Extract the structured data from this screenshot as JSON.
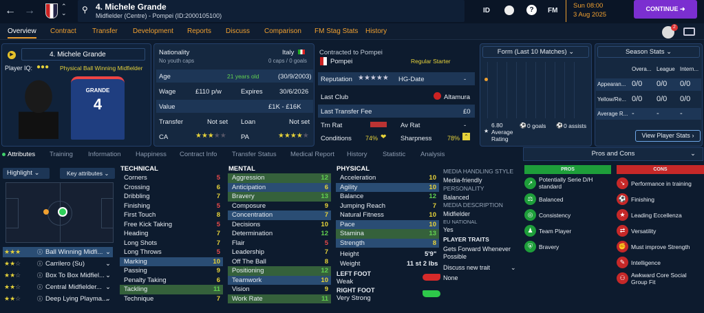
{
  "header": {
    "player_title": "4. Michele Grande",
    "subtitle": "Midfielder (Centre) - Pompei (ID:2000105100)",
    "id_label": "ID",
    "fm_label": "FM",
    "day_time": "Sun 08:00",
    "date": "3 Aug 2025",
    "continue_label": "CONTINUE",
    "notif_count": "2"
  },
  "nav": [
    "Overview",
    "Contract",
    "Transfer",
    "Development",
    "Reports",
    "Discuss",
    "Comparison",
    "FM Stag Stats",
    "History"
  ],
  "profile": {
    "name": "4. Michele Grande",
    "player_iq_label": "Player IQ:",
    "role": "Physical Ball Winning Midfielder",
    "shirt_name": "GRANDE",
    "shirt_number": "4"
  },
  "info": {
    "nationality_label": "Nationality",
    "nationality": "Italy",
    "youth_caps": "No youth caps",
    "caps": "0 caps / 0 goals",
    "age_label": "Age",
    "age": "21 years old",
    "dob": "(30/9/2003)",
    "wage_label": "Wage",
    "wage": "£110 p/w",
    "expires_label": "Expires",
    "expires": "30/6/2026",
    "value_label": "Value",
    "value": "£1K - £16K",
    "transfer_label": "Transfer",
    "transfer": "Not set",
    "loan_label": "Loan",
    "loan": "Not set",
    "ca_label": "CA",
    "pa_label": "PA"
  },
  "club": {
    "contracted_label": "Contracted to Pompei",
    "club": "Pompei",
    "status": "Regular Starter",
    "reputation_label": "Reputation",
    "hg_label": "HG-Date",
    "hg_value": "-",
    "last_club_label": "Last Club",
    "last_club": "Altamura",
    "last_fee_label": "Last Transfer Fee",
    "last_fee": "£0",
    "trn_label": "Trn Rat",
    "av_label": "Av Rat",
    "av_value": "-",
    "conditions_label": "Conditions",
    "conditions": "74%",
    "sharpness_label": "Sharpness",
    "sharpness": "78%"
  },
  "form": {
    "title": "Form (Last 10 Matches)",
    "rating": "6.80",
    "rating_label": "Average Rating",
    "goals": "0 goals",
    "assists": "0 assists"
  },
  "season": {
    "title": "Season Stats",
    "cols": [
      "Overa...",
      "League",
      "Intern..."
    ],
    "rows": [
      {
        "label": "Appearan...",
        "v": [
          "0/0",
          "0/0",
          "0/0"
        ]
      },
      {
        "label": "Yellow/Re...",
        "v": [
          "0/0",
          "0/0",
          "0/0"
        ]
      },
      {
        "label": "Average R...",
        "v": [
          "-",
          "-",
          "-"
        ]
      }
    ],
    "button": "View Player Stats"
  },
  "tabs": [
    "Attributes",
    "Training",
    "Information",
    "Happiness",
    "Contract Info",
    "Transfer Status",
    "Medical Report",
    "History",
    "Statistic",
    "Analysis"
  ],
  "controls": {
    "highlight": "Highlight",
    "key_attributes": "Key attributes"
  },
  "roles": [
    "Ball Winning Midfi...",
    "Carrilero (Su)",
    "Box To Box Midfiel...",
    "Central Midfielder...",
    "Deep Lying Playma..."
  ],
  "technical": {
    "title": "TECHNICAL",
    "items": [
      [
        "Corners",
        "5"
      ],
      [
        "Crossing",
        "6"
      ],
      [
        "Dribbling",
        "7"
      ],
      [
        "Finishing",
        "5"
      ],
      [
        "First Touch",
        "8"
      ],
      [
        "Free Kick Taking",
        "5"
      ],
      [
        "Heading",
        "7"
      ],
      [
        "Long Shots",
        "7"
      ],
      [
        "Long Throws",
        "5"
      ],
      [
        "Marking",
        "10"
      ],
      [
        "Passing",
        "9"
      ],
      [
        "Penalty Taking",
        "6"
      ],
      [
        "Tackling",
        "11"
      ],
      [
        "Technique",
        "7"
      ]
    ]
  },
  "mental": {
    "title": "MENTAL",
    "items": [
      [
        "Aggression",
        "12"
      ],
      [
        "Anticipation",
        "6"
      ],
      [
        "Bravery",
        "13"
      ],
      [
        "Composure",
        "9"
      ],
      [
        "Concentration",
        "7"
      ],
      [
        "Decisions",
        "10"
      ],
      [
        "Determination",
        "12"
      ],
      [
        "Flair",
        "5"
      ],
      [
        "Leadership",
        "7"
      ],
      [
        "Off The Ball",
        "8"
      ],
      [
        "Positioning",
        "12"
      ],
      [
        "Teamwork",
        "10"
      ],
      [
        "Vision",
        "9"
      ],
      [
        "Work Rate",
        "11"
      ]
    ]
  },
  "physical": {
    "title": "PHYSICAL",
    "items": [
      [
        "Acceleration",
        "10"
      ],
      [
        "Agility",
        "10"
      ],
      [
        "Balance",
        "12"
      ],
      [
        "Jumping Reach",
        "7"
      ],
      [
        "Natural Fitness",
        "10"
      ],
      [
        "Pace",
        "10"
      ],
      [
        "Stamina",
        "13"
      ],
      [
        "Strength",
        "8"
      ]
    ],
    "height_label": "Height",
    "height": "5'9\"",
    "weight_label": "Weight",
    "weight": "11 st 2 lbs",
    "left_foot_label": "LEFT FOOT",
    "left_foot": "Weak",
    "right_foot_label": "RIGHT FOOT",
    "right_foot": "Very Strong"
  },
  "side": {
    "media_style_h": "MEDIA HANDLING STYLE",
    "media_style": "Media-friendly",
    "personality_h": "PERSONALITY",
    "personality": "Balanced",
    "media_desc_h": "MEDIA DESCRIPTION",
    "media_desc": "Midfielder",
    "eu_h": "EU NATIONAL",
    "eu": "Yes",
    "traits_h": "PLAYER TRAITS",
    "trait": "Gets Forward Whenever Possible",
    "discuss": "Discuss new trait",
    "none": "None"
  },
  "pros_cons": {
    "title": "Pros and Cons",
    "pros_h": "PROS",
    "cons_h": "CONS",
    "pros": [
      "Potentially Serie D/H standard",
      "Balanced",
      "Consistency",
      "Team Player",
      "Bravery"
    ],
    "cons": [
      "Performance in training",
      "Finishing",
      "Leading Eccellenza",
      "Versatility",
      "Must improve Strength",
      "Intelligence",
      "Awkward Core Social Group Fit"
    ]
  },
  "colors": {
    "accent": "#f0a030",
    "continue": "#7b2fd0",
    "pros": "#1e9e3a",
    "cons": "#c62828"
  }
}
